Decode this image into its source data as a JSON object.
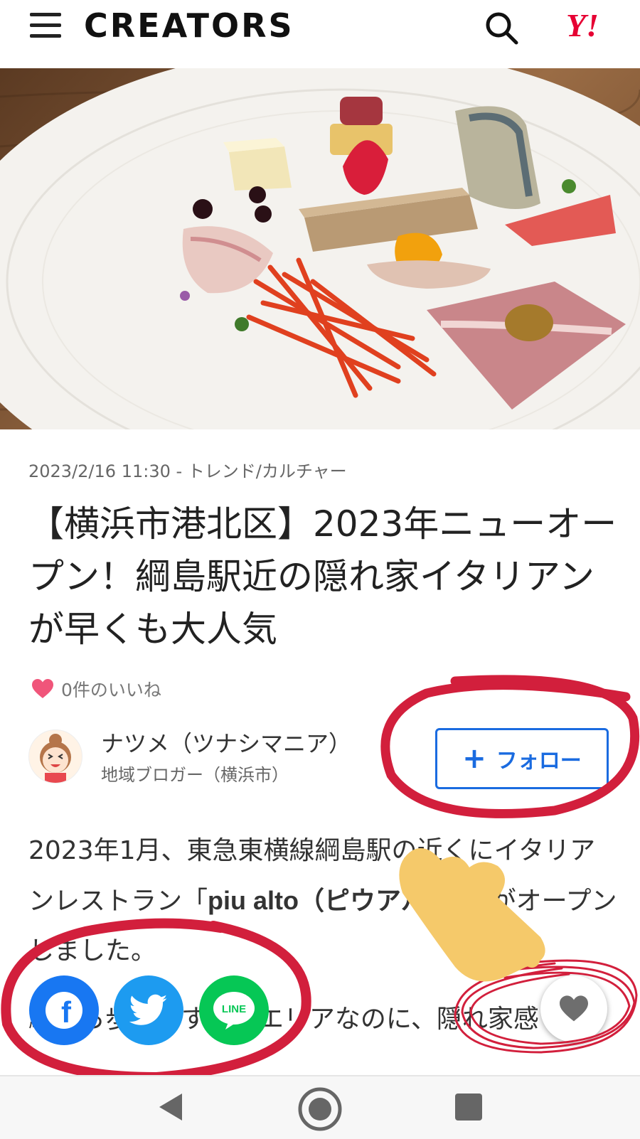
{
  "header": {
    "brand": "CREATORS",
    "yahoo_logo": "Y!",
    "icons": {
      "menu": "hamburger-icon",
      "search": "search-icon"
    }
  },
  "article": {
    "meta": "2023/2/16 11:30 - トレンド/カルチャー",
    "title": "【横浜市港北区】2023年ニューオープン！綱島駅近の隠れ家イタリアンが早くも大人気",
    "likes": "0件のいいね"
  },
  "author": {
    "name": "ナツメ（ツナシマニア）",
    "role": "地域ブロガー（横浜市）",
    "follow_plus": "+",
    "follow_label": "フォロー"
  },
  "body": {
    "p1_before": "2023年1月、東急東横線綱島駅の近くにイタリアンレストラン「",
    "p1_bold": "piu alto（ピウアルト）",
    "p1_after": "」がオープンしました。",
    "p2": "駅から歩いてすぐのエリアなのに、隠れ家感"
  },
  "share": {
    "facebook": "f",
    "line": "LINE"
  },
  "colors": {
    "accent": "#1a6be0",
    "yahoo_red": "#e60033",
    "like_pink": "#f0557a",
    "facebook": "#1877f2",
    "twitter": "#1d9bf0",
    "line": "#06c755",
    "annotation_red": "#d21f3c",
    "pointer_yellow": "#f5c96a"
  }
}
